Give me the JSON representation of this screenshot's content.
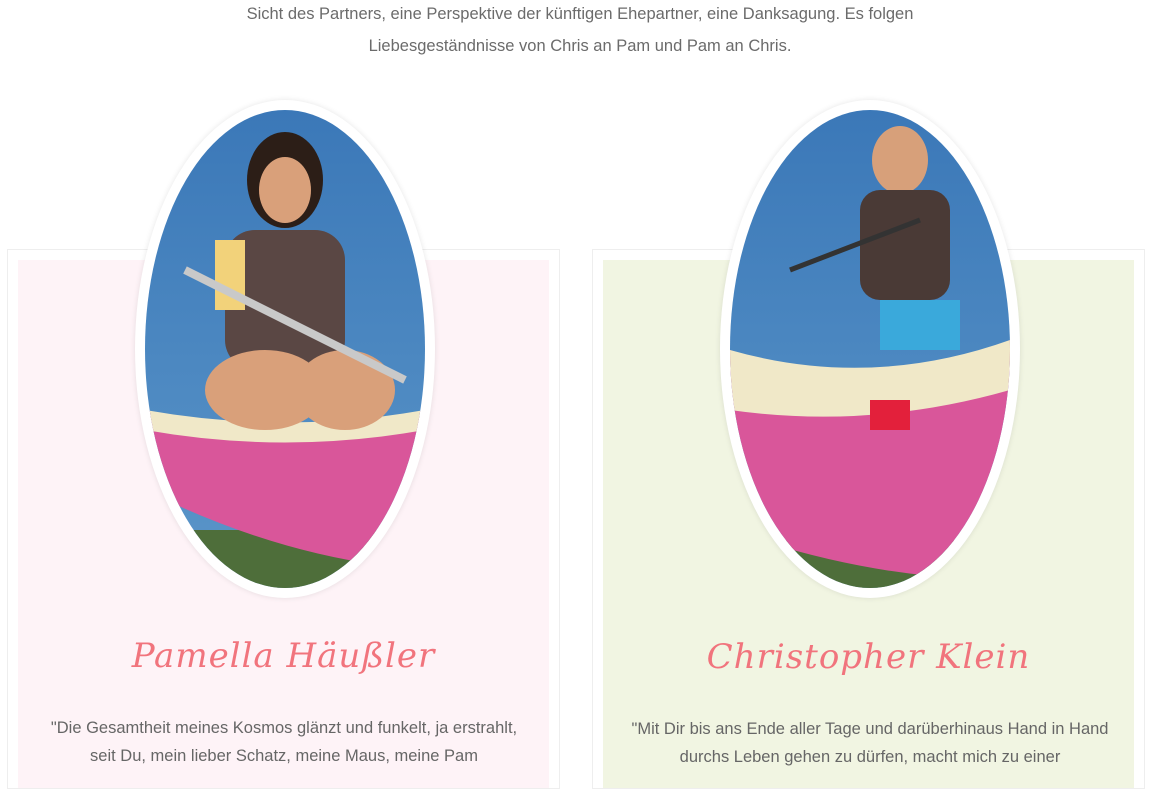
{
  "intro": {
    "text": "Sicht des Partners, eine Perspektive der künftigen Ehepartner, eine Danksagung. Es folgen Liebesgeständnisse von Chris an Pam und Pam an Chris."
  },
  "profiles": [
    {
      "name": "Pamella Häußler",
      "quote": "\"Die Gesamtheit meines Kosmos glänzt und funkelt, ja erstrahlt, seit Du, mein lieber Schatz, meine Maus, meine Pam",
      "photo_subject": "woman-in-pink-canoe",
      "card_color": "#fef3f7"
    },
    {
      "name": "Christopher Klein",
      "quote": "\"Mit Dir bis ans Ende aller Tage und darüberhinaus Hand in Hand durchs Leben gehen zu dürfen, macht mich zu einer",
      "photo_subject": "man-in-pink-canoe",
      "card_color": "#f1f5e2"
    }
  ],
  "colors": {
    "accent_name": "#f1747d",
    "text": "#666666"
  }
}
